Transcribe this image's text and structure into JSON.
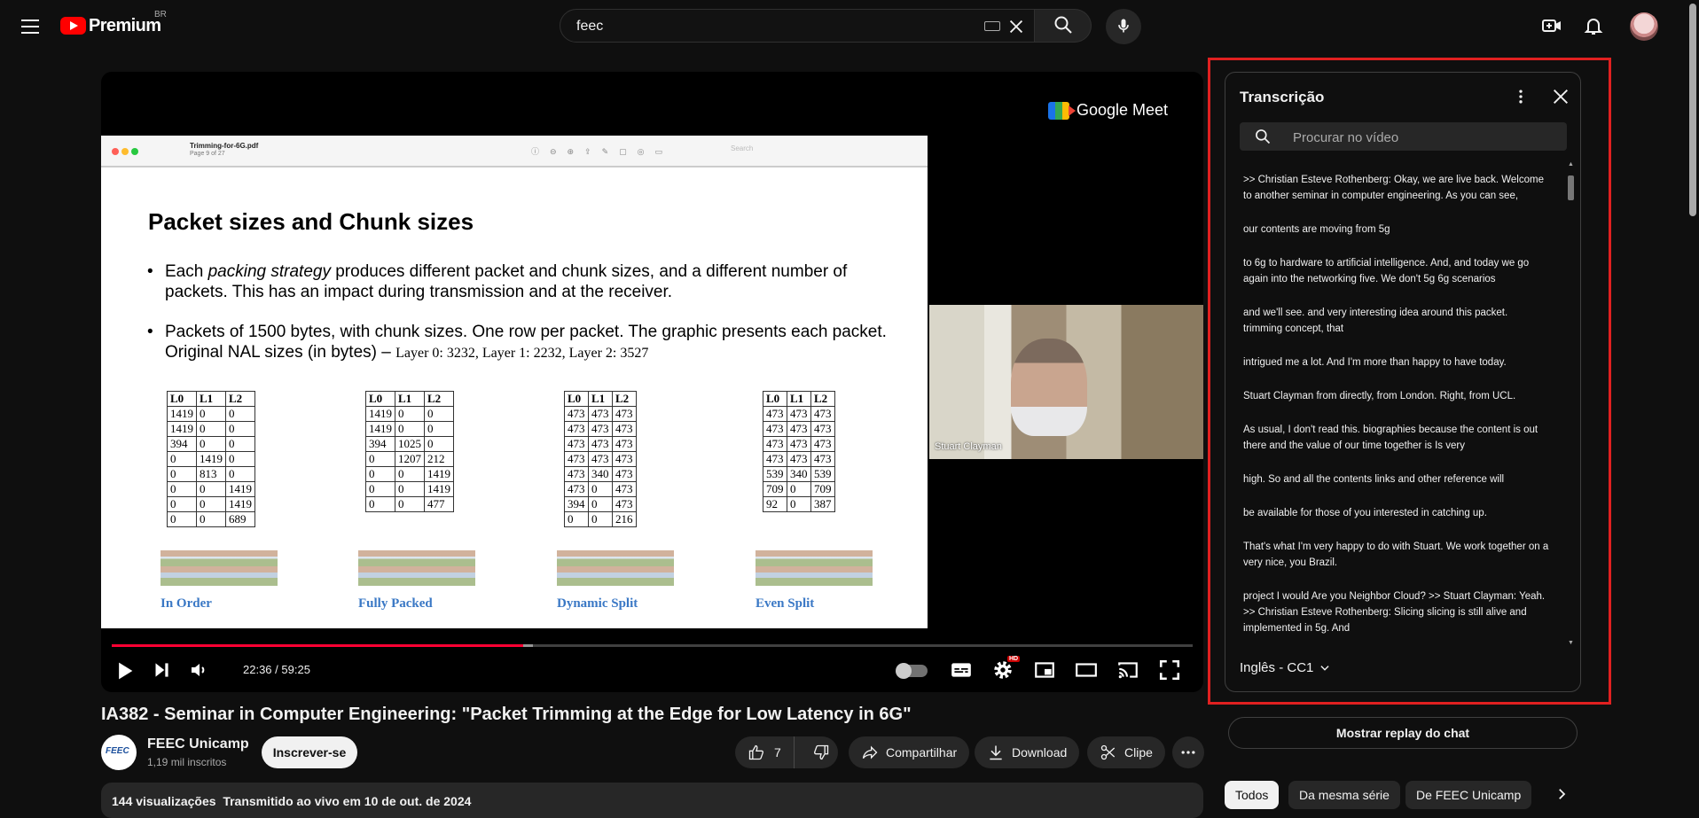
{
  "header": {
    "logo_text": "Premium",
    "region": "BR",
    "search_value": "feec"
  },
  "slide": {
    "pdf_filename": "Trimming-for-6G.pdf",
    "pdf_page": "Page 9 of 27",
    "pdf_search_placeholder": "Search",
    "title": "Packet sizes and Chunk sizes",
    "bullet1_pre": "Each ",
    "bullet1_em": "packing strategy",
    "bullet1_post": " produces different packet and chunk sizes, and a different number of packets.  This has an impact during transmission and at the receiver.",
    "bullet2_main": "Packets of 1500 bytes, with chunk sizes. One row per packet. The graphic presents each packet.    Original NAL sizes (in bytes) – ",
    "bullet2_serif": "Layer 0: 3232, Layer 1: 2232, Layer 2: 3527",
    "table_headers": [
      "L0",
      "L1",
      "L2"
    ],
    "tables": [
      [
        [
          "1419",
          "0",
          "0"
        ],
        [
          "1419",
          "0",
          "0"
        ],
        [
          "394",
          "0",
          "0"
        ],
        [
          "0",
          "1419",
          "0"
        ],
        [
          "0",
          "813",
          "0"
        ],
        [
          "0",
          "0",
          "1419"
        ],
        [
          "0",
          "0",
          "1419"
        ],
        [
          "0",
          "0",
          "689"
        ]
      ],
      [
        [
          "1419",
          "0",
          "0"
        ],
        [
          "1419",
          "0",
          "0"
        ],
        [
          "394",
          "1025",
          "0"
        ],
        [
          "0",
          "1207",
          "212"
        ],
        [
          "0",
          "0",
          "1419"
        ],
        [
          "0",
          "0",
          "1419"
        ],
        [
          "0",
          "0",
          "477"
        ]
      ],
      [
        [
          "473",
          "473",
          "473"
        ],
        [
          "473",
          "473",
          "473"
        ],
        [
          "473",
          "473",
          "473"
        ],
        [
          "473",
          "473",
          "473"
        ],
        [
          "473",
          "340",
          "473"
        ],
        [
          "473",
          "0",
          "473"
        ],
        [
          "394",
          "0",
          "473"
        ],
        [
          "0",
          "0",
          "216"
        ]
      ],
      [
        [
          "473",
          "473",
          "473"
        ],
        [
          "473",
          "473",
          "473"
        ],
        [
          "473",
          "473",
          "473"
        ],
        [
          "473",
          "473",
          "473"
        ],
        [
          "539",
          "340",
          "539"
        ],
        [
          "709",
          "0",
          "709"
        ],
        [
          "92",
          "0",
          "387"
        ]
      ]
    ],
    "captions": [
      "In Order",
      "Fully Packed",
      "Dynamic Split",
      "Even Split"
    ]
  },
  "meet": {
    "brand": "Google Meet",
    "speaker_name": "Stuart Clayman"
  },
  "player": {
    "time_current": "22:36",
    "time_separator": " / ",
    "time_total": "59:25",
    "progress_played": 0.381,
    "progress_buffered": 0.39,
    "hd_badge": "HD",
    "autoplay_on": false
  },
  "transcript": {
    "title": "Transcrição",
    "search_placeholder": "Procurar no vídeo",
    "language": "Inglês - CC1",
    "segments": [
      ">> Christian Esteve Rothenberg: Okay, we are live back. Welcome to another seminar in computer engineering. As you can see,",
      "our contents are moving from 5g",
      "to 6g to hardware to artificial intelligence. And, and today we go again into the networking five. We don't 5g 6g scenarios",
      "and we'll see. and very interesting idea around this packet. trimming concept, that",
      "intrigued me a lot. And I'm more than happy to have today.",
      "Stuart Clayman from directly, from London. Right, from UCL.",
      "As usual, I don't read this. biographies because the content is out there and the value of our time together is Is very",
      "high. So and all the contents links and other reference will",
      "be available for those of you interested in catching up.",
      "That's what I'm very happy to do with Stuart. We work together on a very nice, you Brazil.",
      "project I would Are you Neighbor Cloud? >> Stuart Clayman: Yeah. >> Christian Esteve Rothenberg: Slicing slicing is still alive and implemented in 5g. And"
    ]
  },
  "video": {
    "title": "IA382 - Seminar in Computer Engineering: \"Packet Trimming at the Edge for Low Latency in 6G\"",
    "channel_name": "FEEC Unicamp",
    "channel_avatar_text": "FEEC",
    "subscribers": "1,19 mil inscritos",
    "subscribe_label": "Inscrever-se",
    "like_count": "7",
    "share_label": "Compartilhar",
    "download_label": "Download",
    "clip_label": "Clipe",
    "views": "144 visualizações",
    "streamed": "Transmitido ao vivo em 10 de out. de 2024"
  },
  "sidebar": {
    "chat_replay_label": "Mostrar replay do chat",
    "chips": [
      "Todos",
      "Da mesma série",
      "De FEEC Unicamp"
    ],
    "active_chip": 0
  }
}
